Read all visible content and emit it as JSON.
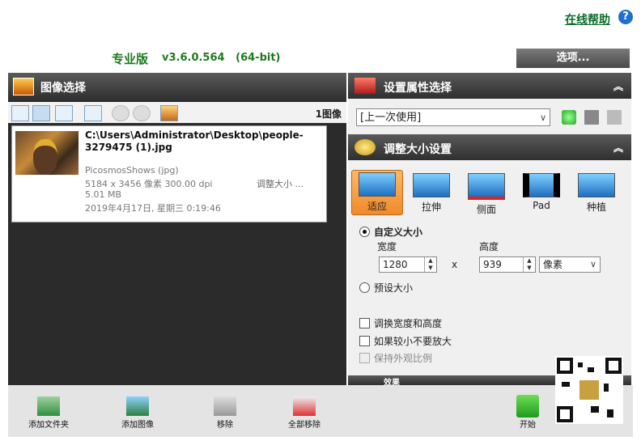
{
  "header": {
    "help_link": "在线帮助",
    "help_icon": "?",
    "edition": "专业版",
    "version": "v3.6.0.564   (64-bit)",
    "options_label": "选项..."
  },
  "left_panel": {
    "title": "图像选择",
    "image_count": "1图像",
    "toolbar_icons": [
      "list-view-icon",
      "thumbnail-view-icon",
      "grid-view-icon",
      "details-view-icon",
      "rotate-left-icon",
      "rotate-right-icon",
      "edit-image-icon"
    ],
    "file": {
      "path": "C:\\Users\\Administrator\\Desktop\\people-3279475 (1).jpg",
      "source": "PicosmosShows (jpg)",
      "dimensions": "5184 x 3456 像素 300.00 dpi",
      "size": "5.01 MB",
      "date": "2019年4月17日, 星期三 0:19:46",
      "resize_note": "调整大小 ..."
    }
  },
  "bottom_bar": {
    "add_folder": "添加文件夹",
    "add_image": "添加图像",
    "remove": "移除",
    "remove_all": "全部移除",
    "start": "开始"
  },
  "right_panel": {
    "preset_title": "设置属性选择",
    "preset_value": "[上一次使用]",
    "resize_title": "调整大小设置",
    "modes": [
      {
        "label": "适应",
        "selected": true
      },
      {
        "label": "拉伸",
        "selected": false
      },
      {
        "label": "侧面",
        "selected": false
      },
      {
        "label": "Pad",
        "selected": false
      },
      {
        "label": "种植",
        "selected": false
      }
    ],
    "custom_size_label": "自定义大小",
    "width_label": "宽度",
    "height_label": "高度",
    "width_value": "1280",
    "height_value": "939",
    "times": "x",
    "unit": "像素",
    "preset_size_label": "预设大小",
    "swap_label": "调换宽度和高度",
    "no_enlarge_label": "如果较小不要放大",
    "keep_ratio_label": "保持外观比例",
    "next_section": "效果"
  },
  "colors": {
    "title_bar": "#3a3a3a",
    "help_green": "#0a6b2a",
    "selected_mode": "#f08a2a"
  }
}
